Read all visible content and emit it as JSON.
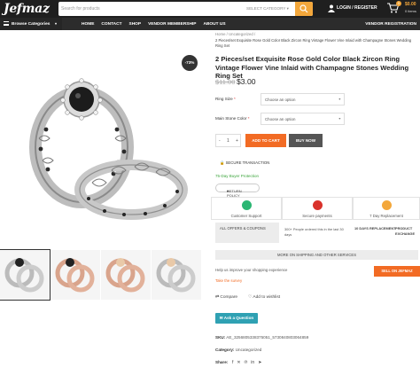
{
  "header": {
    "logo": "Jefmaz",
    "search_placeholder": "Search for products",
    "search_category": "SELECT CATEGORY",
    "login_label": "LOGIN / REGISTER",
    "cart_count": "0",
    "cart_total": "$0.00",
    "cart_items": "0 items",
    "accent_color": "#f3a73b"
  },
  "nav": {
    "browse": "Browse Categories",
    "links": [
      "HOME",
      "CONTACT",
      "SHOP",
      "VENDOR MEMBERSHIP",
      "ABOUT US"
    ],
    "vendor_registration": "VENDOR REGISTRATION"
  },
  "product": {
    "discount_badge": "-73%",
    "breadcrumb_home": "Home",
    "breadcrumb_sep": "/",
    "breadcrumb_category": "Uncategorized",
    "breadcrumb_product": "2 Pieces/set Exquisite Rose Gold Color Black Zircon Ring Vintage Flower Vine Inlaid with Champagne Stones Wedding Ring Set",
    "title": "2 Pieces/set Exquisite Rose Gold Color Black Zircon Ring Vintage Flower Vine Inlaid with Champagne Stones Wedding Ring Set",
    "price_old": "$11.00",
    "price_new": "$3.00",
    "options": [
      {
        "label": "Ring Size",
        "required": "*",
        "value": "Choose an option"
      },
      {
        "label": "Main Stone Color",
        "required": "*",
        "value": "Choose an option"
      }
    ],
    "qty_minus": "-",
    "qty_value": "1",
    "qty_plus": "+",
    "add_to_cart": "ADD TO CART",
    "buy_now": "BUY NOW",
    "secure": "SECURE TRANSACTION",
    "protection": "75-Day Buyer Protection",
    "return_policy": "RETURN POLICY",
    "features": [
      {
        "label": "Customer Support",
        "color": "#2bb673"
      },
      {
        "label": "Secure payments",
        "color": "#d9322b"
      },
      {
        "label": "7 Day Replacement",
        "color": "#f3a73b"
      }
    ],
    "offers": "ALL OFFERS & COUPONS",
    "people_text": "300+ People ordered this in the last 30 days",
    "replacement": "10 DAYS REPLACEMENT",
    "exchange": "PRODUCT EXCHANGE",
    "shipping": "MORE ON SHIPPING AND OTHER SERVICES",
    "survey_text": "Help us improve your shopping experience",
    "survey_link": "Take the survey",
    "sell_button": "SELL ON JEFMAZ",
    "compare": "Compare",
    "wishlist": "Add to wishlist",
    "ask_question": "Ask a Question",
    "sku_label": "SKU:",
    "sku_value": "AE_3256805338375051_5730840803064859",
    "category_label": "Category:",
    "category_value": "Uncategorized",
    "share_label": "Share:"
  }
}
